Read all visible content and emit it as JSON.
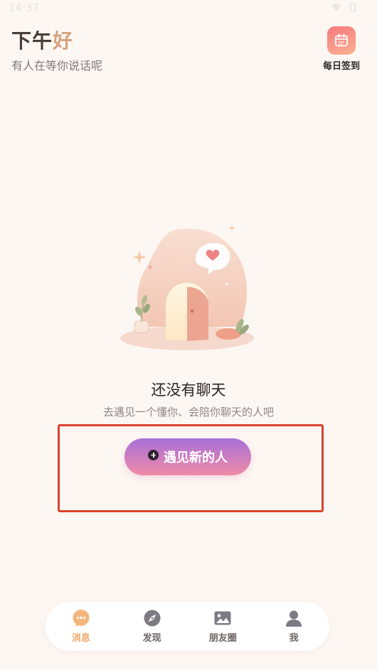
{
  "status_bar": {
    "time": "14:37"
  },
  "header": {
    "greeting_part1": "下午",
    "greeting_part2": "好",
    "subtitle": "有人在等你说话呢",
    "checkin_label": "每日签到",
    "checkin_icon": "calendar-icon"
  },
  "empty_state": {
    "title": "还没有聊天",
    "description": "去遇见一个懂你、会陪你聊天的人吧",
    "button_label": "遇见新的人",
    "illustration_icon": "door-heart-illustration"
  },
  "tabbar": {
    "items": [
      {
        "label": "消息",
        "icon": "chat-bubble-icon",
        "active": true
      },
      {
        "label": "发现",
        "icon": "compass-icon",
        "active": false
      },
      {
        "label": "朋友圈",
        "icon": "image-icon",
        "active": false
      },
      {
        "label": "我",
        "icon": "user-icon",
        "active": false
      }
    ]
  },
  "colors": {
    "background": "#fdf7f3",
    "accent": "#f0a86a",
    "button_gradient_top": "#a770d8",
    "button_gradient_bottom": "#f08aa8",
    "highlight": "#d9432e"
  }
}
